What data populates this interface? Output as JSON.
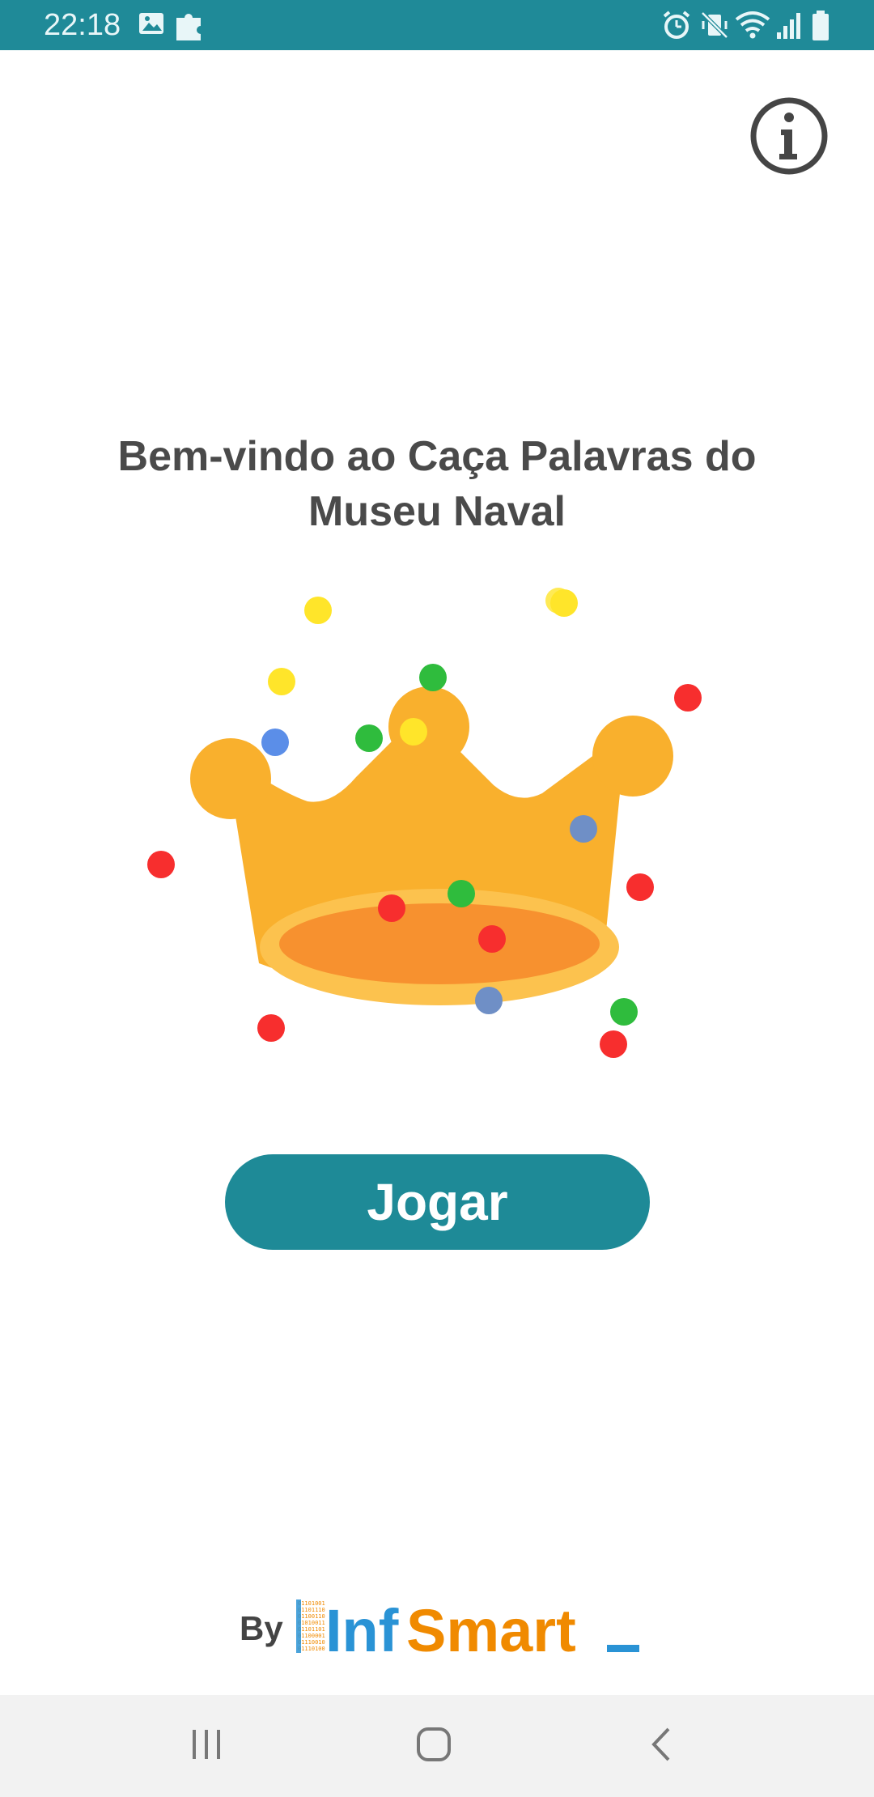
{
  "status_bar": {
    "time": "22:18",
    "left_icons": [
      "image-icon",
      "puzzle-icon"
    ],
    "right_icons": [
      "alarm-icon",
      "vibrate-mute-icon",
      "wifi-icon",
      "signal-icon",
      "battery-icon"
    ],
    "background_color": "#1f8a98"
  },
  "header": {
    "info_icon": "info-icon"
  },
  "main": {
    "title": "Bem-vindo ao Caça Palavras do Museu Naval",
    "illustration": "crown-icon",
    "play_label": "Jogar",
    "accent_color": "#1e8a97",
    "crown_color": "#f9b02d"
  },
  "footer": {
    "by_label": "By",
    "brand_part1": "Inf",
    "brand_part2": "Smart",
    "brand_colors": {
      "inf": "#2a93d5",
      "smart": "#f08a00"
    }
  },
  "nav_bar": {
    "buttons": [
      "recents-icon",
      "home-icon",
      "back-icon"
    ]
  }
}
